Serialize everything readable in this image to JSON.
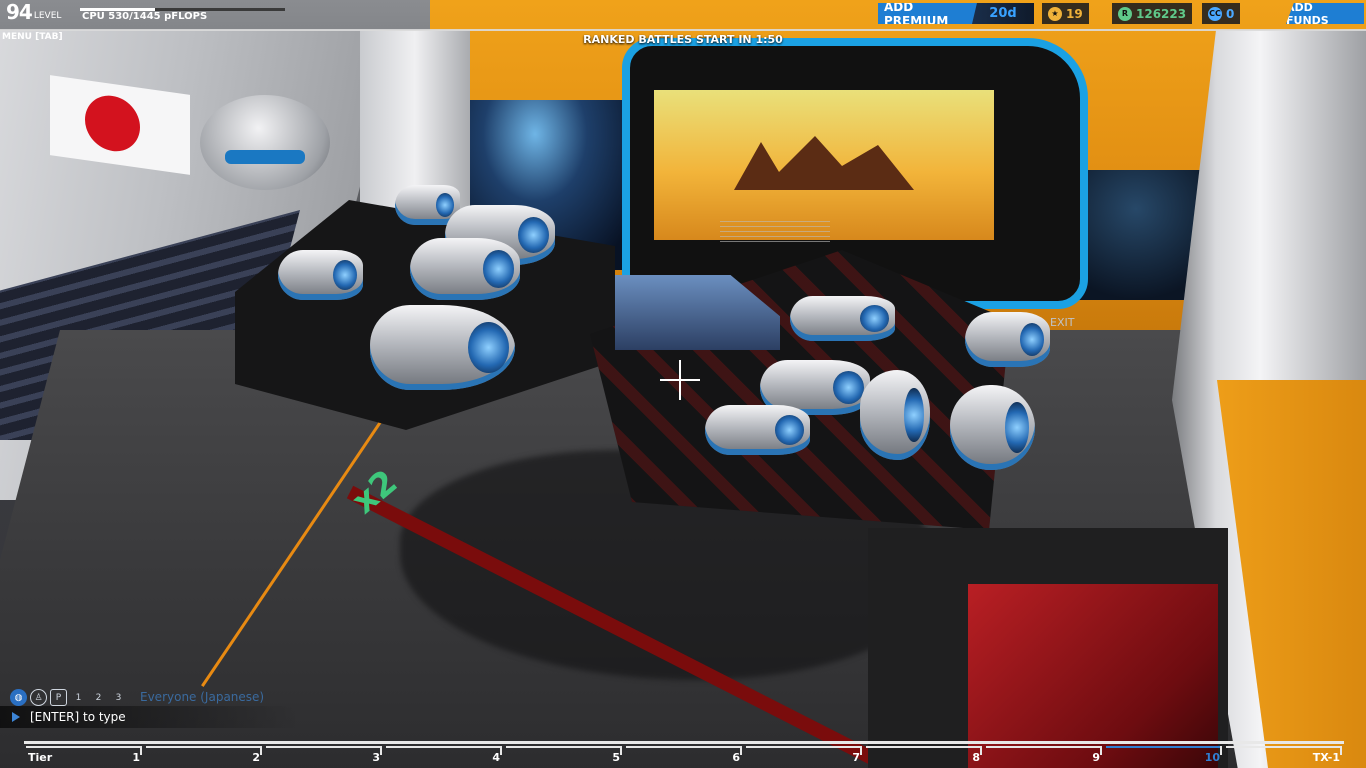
{
  "player": {
    "level_number": "94",
    "level_label": "LEVEL",
    "cpu_text": "CPU 530/1445 pFLOPS",
    "cpu_used": 530,
    "cpu_max": 1445
  },
  "menu": {
    "label": "MENU [TAB]"
  },
  "banner": {
    "ranked_text": "RANKED BATTLES START IN 1:50"
  },
  "topbar": {
    "add_premium_label": "ADD PREMIUM",
    "premium_days": "20d",
    "tech_points": "19",
    "robits": "126223",
    "cosmetic_credits": "0",
    "add_funds_label": "ADD FUNDS",
    "colors": {
      "accent": "#1e7ed3",
      "robits": "#5fc98a",
      "cc": "#4aa8ff",
      "tech": "#f0b23a"
    }
  },
  "scene": {
    "axis_label": "x2",
    "exit_sign": "EXIT"
  },
  "chat": {
    "channel": "Everyone (Japanese)",
    "input_hint": "[ENTER] to type",
    "icons": [
      "globe-icon",
      "accessibility-icon",
      "party-icon",
      "one-player-icon",
      "two-player-icon",
      "three-player-icon"
    ]
  },
  "tiers": {
    "label": "Tier",
    "items": [
      "1",
      "2",
      "3",
      "4",
      "5",
      "6",
      "7",
      "8",
      "9",
      "10",
      "TX-1"
    ],
    "active": "10"
  }
}
